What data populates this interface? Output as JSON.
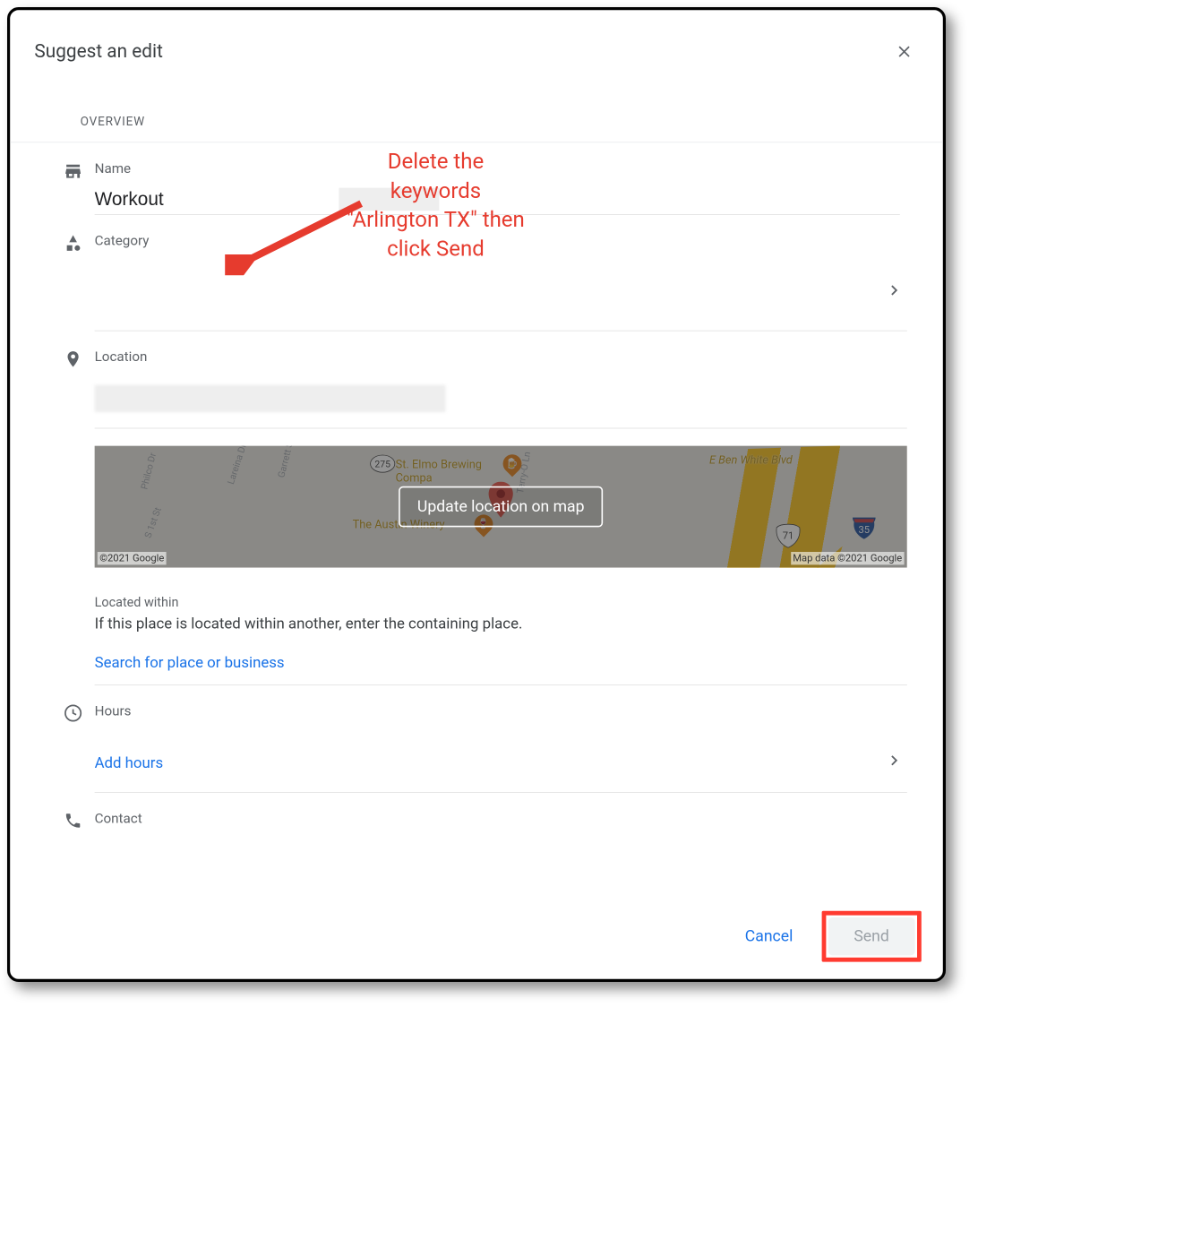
{
  "dialog": {
    "title": "Suggest an edit",
    "overview_label": "OVERVIEW"
  },
  "name": {
    "label": "Name",
    "value": "Workout "
  },
  "category": {
    "label": "Category"
  },
  "location": {
    "label": "Location",
    "map_button": "Update location on map",
    "copyright_left": "©2021 Google",
    "copyright_right": "Map data ©2021 Google",
    "poi_labels": {
      "elmo": "St. Elmo Brewing\nCompa",
      "winery": "The Austin Winery",
      "road": "E Ben White Blvd"
    },
    "shields": {
      "ellipse": "275",
      "hw1": "71",
      "hw2": "35"
    },
    "located_within_label": "Located within",
    "located_within_desc": "If this place is located within another, enter the containing place.",
    "search_link": "Search for place or business"
  },
  "hours": {
    "label": "Hours",
    "add_link": "Add hours"
  },
  "contact": {
    "label": "Contact"
  },
  "footer": {
    "cancel": "Cancel",
    "send": "Send"
  },
  "annotation": {
    "line1": "Delete the",
    "line2": "keywords",
    "line3": "\"Arlington TX\" then",
    "line4": "click Send"
  }
}
